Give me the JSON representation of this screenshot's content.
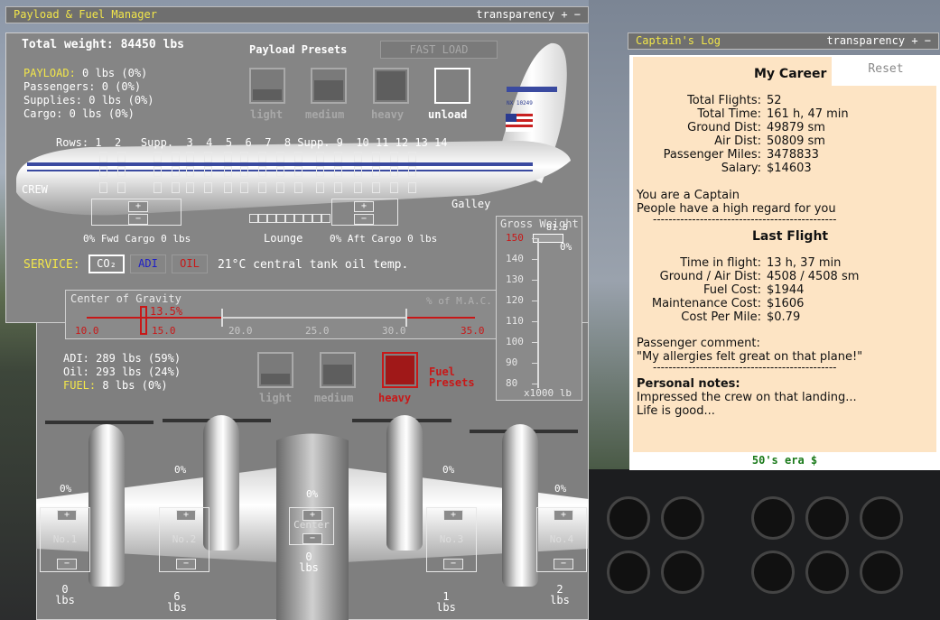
{
  "payload_panel": {
    "title": "Payload & Fuel Manager",
    "transparency": "transparency + −",
    "total_weight": "Total weight: 84450 lbs",
    "payload_label": "PAYLOAD:",
    "payload_value": "0 lbs (0%)",
    "passengers": "Passengers: 0 (0%)",
    "supplies": "Supplies: 0 lbs (0%)",
    "cargo": "Cargo: 0 lbs (0%)",
    "presets_label": "Payload Presets",
    "fast_load": "FAST LOAD",
    "preset_light": "light",
    "preset_medium": "medium",
    "preset_heavy": "heavy",
    "preset_unload": "unload",
    "rows_label": "Rows: 1  2   Supp.  3  4  5  6  7  8 Supp. 9  10 11 12 13 14",
    "crew": "CREW",
    "galley": "Galley",
    "lounge": "Lounge",
    "fwd_cargo": "0% Fwd Cargo 0 lbs",
    "aft_cargo": "0% Aft Cargo 0 lbs",
    "service_label": "SERVICE:",
    "service_co2": "CO₂",
    "service_adi": "ADI",
    "service_oil": "OIL",
    "oil_temp": "21°C central tank oil temp.",
    "plus": "+",
    "minus": "−",
    "registration": "NX 10249"
  },
  "cg": {
    "title": "Center of Gravity",
    "mac_label": "% of M.A.C.",
    "value": "13.5%",
    "ticks": [
      "10.0",
      "15.0",
      "20.0",
      "25.0",
      "30.0",
      "35.0"
    ]
  },
  "gross_weight": {
    "title": "Gross Weight",
    "value": "81.5",
    "percent": "0%",
    "ticks": [
      "150",
      "140",
      "130",
      "120",
      "110",
      "100",
      "90",
      "80"
    ],
    "unit": "x1000 lb"
  },
  "fuel": {
    "adi": "ADI: 289 lbs (59%)",
    "oil": "Oil: 293 lbs (24%)",
    "fuel_label": "FUEL:",
    "fuel_value": "8 lbs (0%)",
    "preset_light": "light",
    "preset_medium": "medium",
    "preset_heavy": "heavy",
    "presets_label_1": "Fuel",
    "presets_label_2": "Presets",
    "tanks": [
      {
        "name": "No.1",
        "percent": "0%",
        "lbs": "0",
        "unit": "lbs"
      },
      {
        "name": "No.2",
        "percent": "0%",
        "lbs": "6",
        "unit": "lbs"
      },
      {
        "name": "Center",
        "percent": "0%",
        "lbs": "0",
        "unit": "lbs"
      },
      {
        "name": "No.3",
        "percent": "0%",
        "lbs": "1",
        "unit": "lbs"
      },
      {
        "name": "No.4",
        "percent": "0%",
        "lbs": "2",
        "unit": "lbs"
      }
    ]
  },
  "log": {
    "title": "Captain's Log",
    "transparency": "transparency + −",
    "tab_career": "My Career",
    "tab_reset": "Reset",
    "career": [
      {
        "k": "Total Flights:",
        "v": "52"
      },
      {
        "k": "Total Time:",
        "v": "161 h, 47 min"
      },
      {
        "k": "Ground Dist:",
        "v": "49879 sm"
      },
      {
        "k": "Air Dist:",
        "v": "50809 sm"
      },
      {
        "k": "Passenger Miles:",
        "v": "3478833"
      },
      {
        "k": "Salary:",
        "v": "$14603"
      }
    ],
    "rank": "You are a Captain",
    "regard": "People have a high regard for you",
    "separator": "-----------------------------------------------",
    "last_flight_title": "Last Flight",
    "last_flight": [
      {
        "k": "Time in flight:",
        "v": "13 h, 37 min"
      },
      {
        "k": "Ground / Air Dist:",
        "v": "4508 / 4508 sm"
      },
      {
        "k": "Fuel Cost:",
        "v": "$1944"
      },
      {
        "k": "Maintenance Cost:",
        "v": "$1606"
      },
      {
        "k": "Cost Per Mile:",
        "v": "$0.79"
      }
    ],
    "comment_label": "Passenger comment:",
    "comment": "\"My allergies felt great on that plane!\"",
    "notes_label": "Personal notes:",
    "note_1": "Impressed the crew on that landing...",
    "note_2": "Life is good...",
    "footer": "50's era $"
  }
}
